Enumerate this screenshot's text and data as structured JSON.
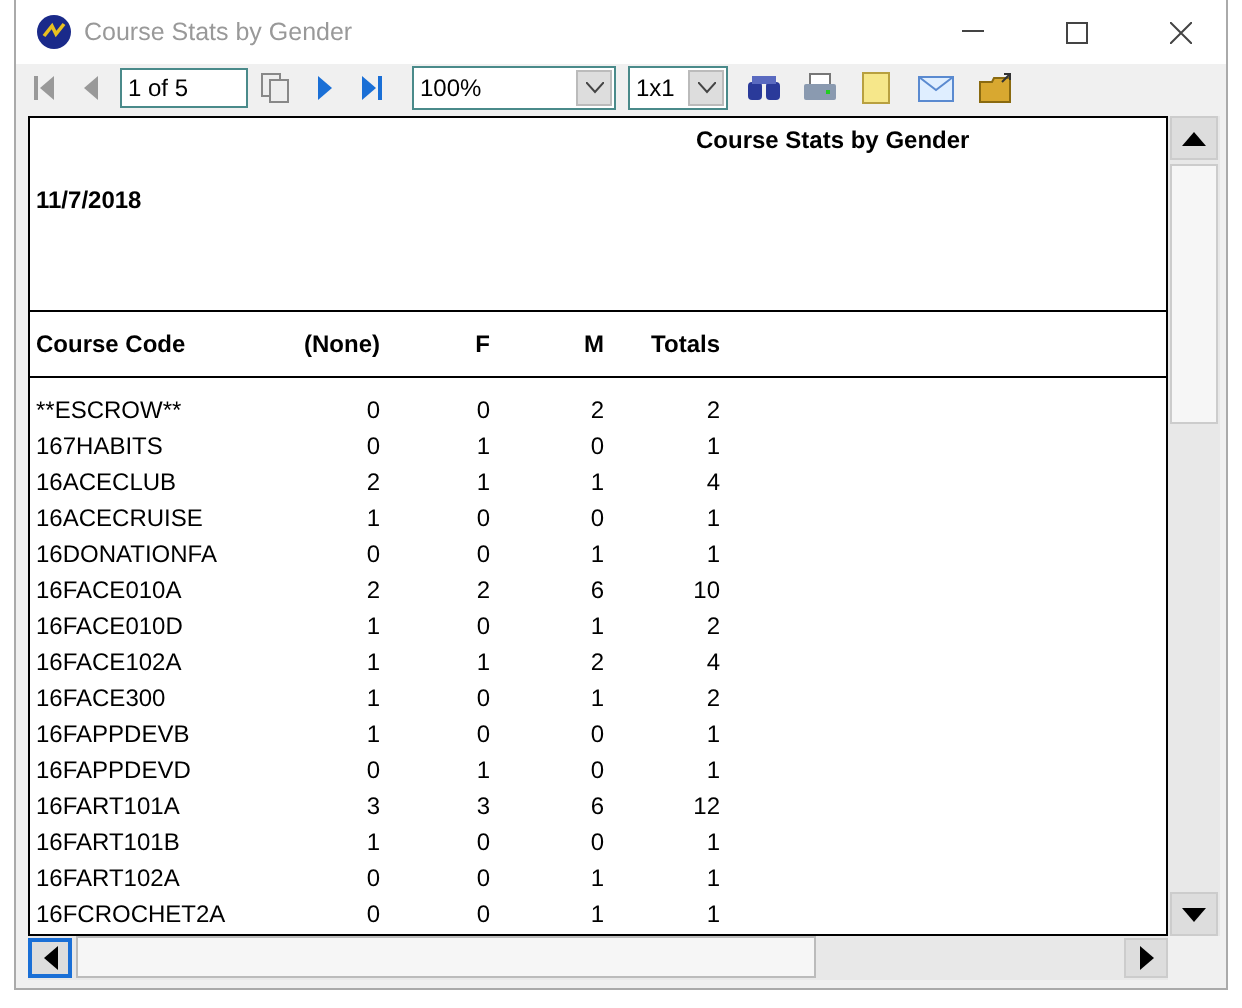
{
  "window": {
    "title": "Course Stats by Gender"
  },
  "toolbar": {
    "page": "1 of 5",
    "zoom": "100%",
    "layout": "1x1"
  },
  "report": {
    "title": "Course Stats by Gender",
    "date": "11/7/2018",
    "columns": [
      "Course Code",
      "(None)",
      "F",
      "M",
      "Totals"
    ],
    "rows": [
      [
        "**ESCROW**",
        "0",
        "0",
        "2",
        "2"
      ],
      [
        "167HABITS",
        "0",
        "1",
        "0",
        "1"
      ],
      [
        "16ACECLUB",
        "2",
        "1",
        "1",
        "4"
      ],
      [
        "16ACECRUISE",
        "1",
        "0",
        "0",
        "1"
      ],
      [
        "16DONATIONFA",
        "0",
        "0",
        "1",
        "1"
      ],
      [
        "16FACE010A",
        "2",
        "2",
        "6",
        "10"
      ],
      [
        "16FACE010D",
        "1",
        "0",
        "1",
        "2"
      ],
      [
        "16FACE102A",
        "1",
        "1",
        "2",
        "4"
      ],
      [
        "16FACE300",
        "1",
        "0",
        "1",
        "2"
      ],
      [
        "16FAPPDEVB",
        "1",
        "0",
        "0",
        "1"
      ],
      [
        "16FAPPDEVD",
        "0",
        "1",
        "0",
        "1"
      ],
      [
        "16FART101A",
        "3",
        "3",
        "6",
        "12"
      ],
      [
        "16FART101B",
        "1",
        "0",
        "0",
        "1"
      ],
      [
        "16FART102A",
        "0",
        "0",
        "1",
        "1"
      ],
      [
        "16FCROCHET2A",
        "0",
        "0",
        "1",
        "1"
      ]
    ]
  }
}
